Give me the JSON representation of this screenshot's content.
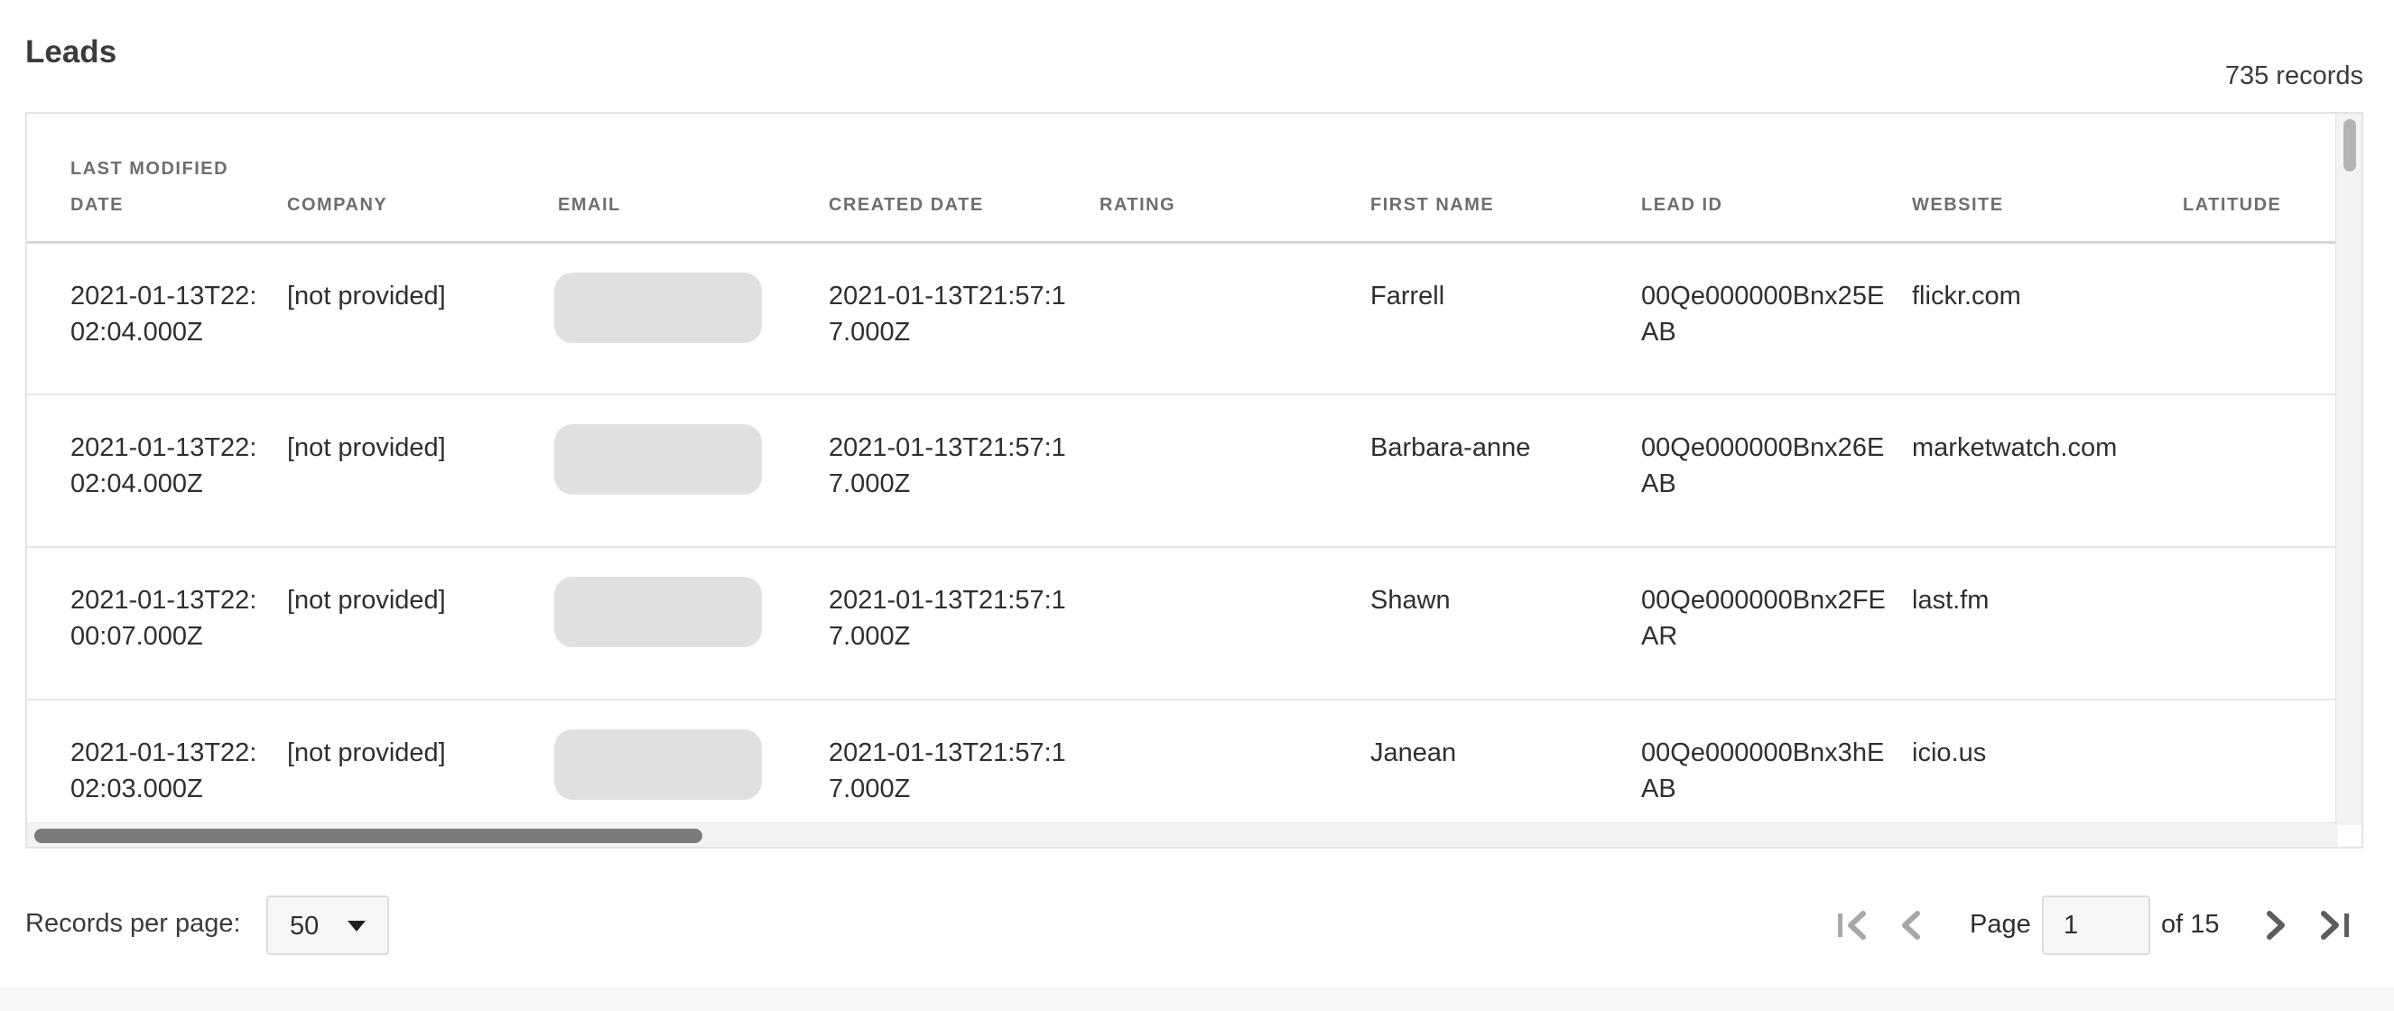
{
  "header": {
    "title": "Leads",
    "records_count": "735 records"
  },
  "table": {
    "columns": [
      "LAST MODIFIED DATE",
      "COMPANY",
      "EMAIL",
      "CREATED DATE",
      "RATING",
      "FIRST NAME",
      "LEAD ID",
      "WEBSITE",
      "LATITUDE"
    ],
    "rows": [
      {
        "last_modified_date": "2021-01-13T22:02:04.000Z",
        "company": "[not provided]",
        "email": "",
        "created_date": "2021-01-13T21:57:17.000Z",
        "rating": "",
        "first_name": "Farrell",
        "lead_id": "00Qe000000Bnx25EAB",
        "website": "flickr.com",
        "latitude": ""
      },
      {
        "last_modified_date": "2021-01-13T22:02:04.000Z",
        "company": "[not provided]",
        "email": "",
        "created_date": "2021-01-13T21:57:17.000Z",
        "rating": "",
        "first_name": "Barbara-anne",
        "lead_id": "00Qe000000Bnx26EAB",
        "website": "marketwatch.com",
        "latitude": ""
      },
      {
        "last_modified_date": "2021-01-13T22:00:07.000Z",
        "company": "[not provided]",
        "email": "",
        "created_date": "2021-01-13T21:57:17.000Z",
        "rating": "",
        "first_name": "Shawn",
        "lead_id": "00Qe000000Bnx2FEAR",
        "website": "last.fm",
        "latitude": ""
      },
      {
        "last_modified_date": "2021-01-13T22:02:03.000Z",
        "company": "[not provided]",
        "email": "",
        "created_date": "2021-01-13T21:57:17.000Z",
        "rating": "",
        "first_name": "Janean",
        "lead_id": "00Qe000000Bnx3hEAB",
        "website": "icio.us",
        "latitude": ""
      }
    ]
  },
  "pagination": {
    "records_per_page_label": "Records per page:",
    "records_per_page_value": "50",
    "page_label": "Page",
    "current_page": "1",
    "of_label": "of 15",
    "icons": {
      "first": "first-page-icon",
      "prev": "previous-page-icon",
      "next": "next-page-icon",
      "last": "last-page-icon",
      "dropdown": "chevron-down-icon"
    }
  },
  "colors": {
    "header_text": "#6e6e72",
    "body_text": "#2f2f2f",
    "redacted_email": "#e2dfe3",
    "disabled_pager": "#a8a8ab",
    "enabled_pager": "#5c5c60"
  }
}
